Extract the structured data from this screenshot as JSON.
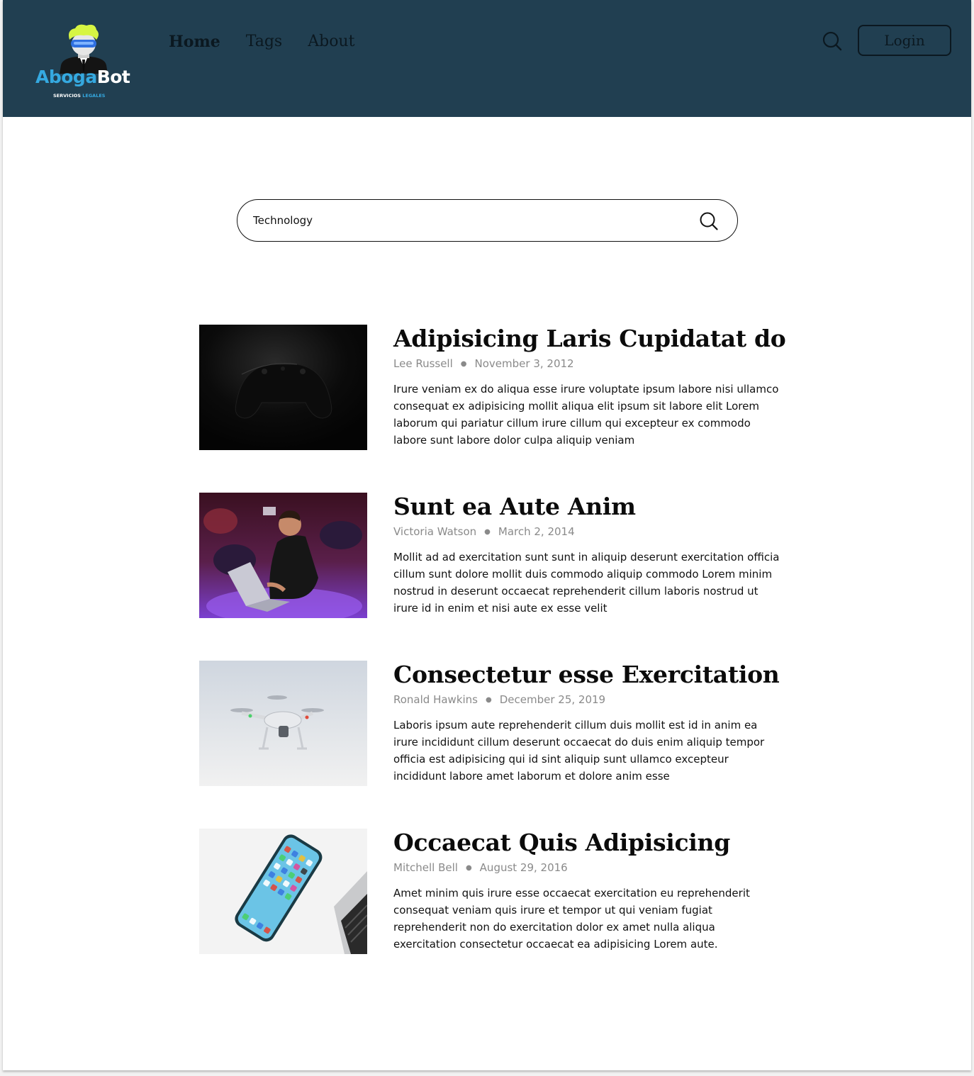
{
  "header": {
    "logo": {
      "name": [
        "Aboga",
        "Bot"
      ],
      "tagline": [
        "SERVICIOS",
        "LEGALES"
      ]
    },
    "nav": [
      {
        "label": "Home",
        "active": true
      },
      {
        "label": "Tags",
        "active": false
      },
      {
        "label": "About",
        "active": false
      }
    ],
    "search_icon": "search-icon",
    "login_label": "Login",
    "colors": {
      "background": "#213f51",
      "logo_accent": "#35a9e0",
      "hair": "#d7f542"
    }
  },
  "search": {
    "value": "Technology",
    "icon": "search-icon"
  },
  "articles": [
    {
      "title": "Adipisicing Laris Cupidatat do",
      "author": "Lee Russell",
      "date": "November 3, 2012",
      "excerpt": "Irure veniam ex do aliqua esse irure voluptate ipsum labore nisi ullamco consequat ex adipisicing mollit aliqua elit ipsum sit labore elit Lorem laborum qui pariatur cillum irure cillum qui excepteur ex commodo labore sunt labore dolor culpa aliquip veniam",
      "image": "game-controller"
    },
    {
      "title": "Sunt ea Aute Anim",
      "author": "Victoria Watson",
      "date": "March 2, 2014",
      "excerpt": "Mollit ad ad exercitation sunt sunt in aliquip deserunt exercitation officia cillum sunt dolore mollit duis commodo aliquip commodo Lorem minim nostrud in deserunt occaecat reprehenderit cillum laboris nostrud ut irure id in enim et nisi aute ex esse velit",
      "image": "person-with-laptop"
    },
    {
      "title": "Consectetur esse Exercitation",
      "author": "Ronald Hawkins",
      "date": "December 25, 2019",
      "excerpt": "Laboris ipsum aute reprehenderit cillum duis mollit est id in anim ea irure incididunt cillum deserunt occaecat do duis enim aliquip tempor officia est adipisicing qui id sint aliquip sunt ullamco excepteur incididunt labore amet laborum et dolore anim esse",
      "image": "drone"
    },
    {
      "title": "Occaecat Quis Adipisicing",
      "author": "Mitchell Bell",
      "date": "August 29, 2016",
      "excerpt": "Amet minim quis irure esse occaecat exercitation eu reprehenderit consequat veniam quis irure et tempor ut qui veniam fugiat reprehenderit non do exercitation dolor ex amet nulla aliqua exercitation consectetur occaecat ea adipisicing Lorem aute.",
      "image": "smartphone"
    }
  ]
}
